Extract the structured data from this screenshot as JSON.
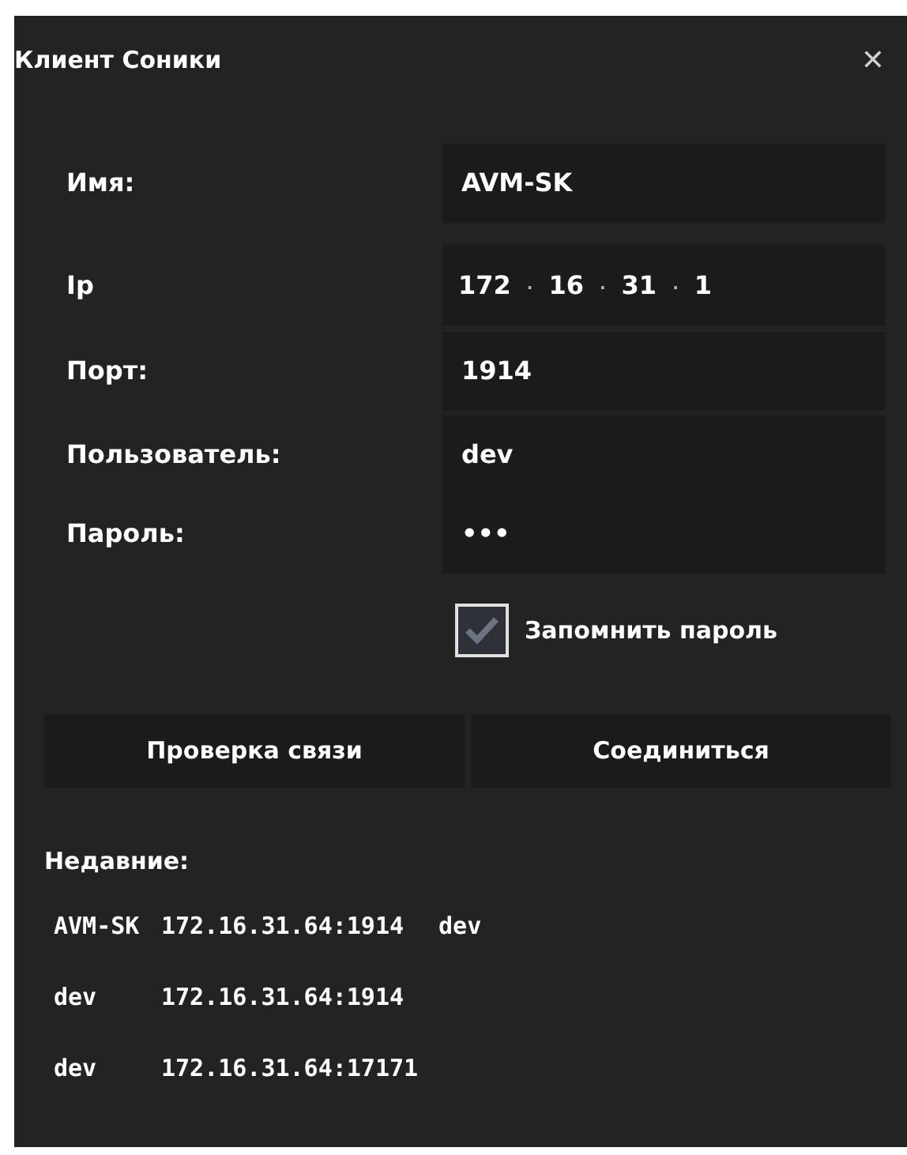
{
  "window": {
    "title": "Клиент Соники",
    "close": "✕"
  },
  "form": {
    "name": {
      "label": "Имя:",
      "value": "AVM-SK"
    },
    "ip": {
      "label": "Ip",
      "octets": [
        "172",
        "16",
        "31",
        "1"
      ],
      "separator": "."
    },
    "port": {
      "label": "Порт:",
      "value": "1914"
    },
    "user": {
      "label": "Пользователь:",
      "value": "dev"
    },
    "password": {
      "label": "Пароль:",
      "value": "•••"
    },
    "remember": {
      "label": "Запомнить пароль",
      "checked": true
    }
  },
  "buttons": [
    "Проверка связи",
    "Соединиться"
  ],
  "recent": {
    "title": "Недавние:",
    "items": [
      {
        "name": "AVM-SK",
        "address": "172.16.31.64:1914",
        "user": "dev"
      },
      {
        "name": "dev",
        "address": "172.16.31.64:1914"
      },
      {
        "name": "dev",
        "address": "172.16.31.64:17171"
      }
    ]
  }
}
